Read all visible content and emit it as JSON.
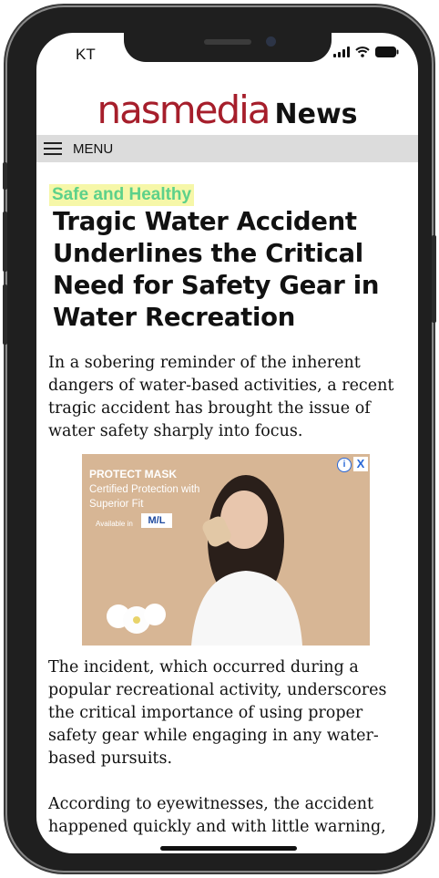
{
  "status_bar": {
    "carrier": "KT"
  },
  "brand": {
    "logo_text": "nasmedia",
    "suffix": "News"
  },
  "nav": {
    "menu_label": "MENU"
  },
  "article": {
    "category": "Safe and Healthy",
    "headline": "Tragic Water Accident Underlines the Critical Need for Safety Gear in Water Recreation",
    "paragraphs": [
      "In a sobering reminder of the inherent dangers of water-based activities, a recent tragic accident has brought the issue of water safety sharply into focus.",
      "The incident, which occurred during a popular recreational activity, underscores the critical importance of using proper safety gear while engaging in any water-based pursuits.",
      "According to eyewitnesses, the accident happened quickly and with little warning,"
    ]
  },
  "ad": {
    "title": "PROTECT MASK",
    "subtitle": "Certified Protection with Superior Fit",
    "available_label": "Available in",
    "sizes": "M/L",
    "info_label": "i",
    "close_label": "X"
  },
  "colors": {
    "brand_red": "#a61e2b",
    "category_text": "#5dd18a",
    "category_highlight": "#f6f7a8",
    "menu_bar": "#dcdcdc"
  }
}
